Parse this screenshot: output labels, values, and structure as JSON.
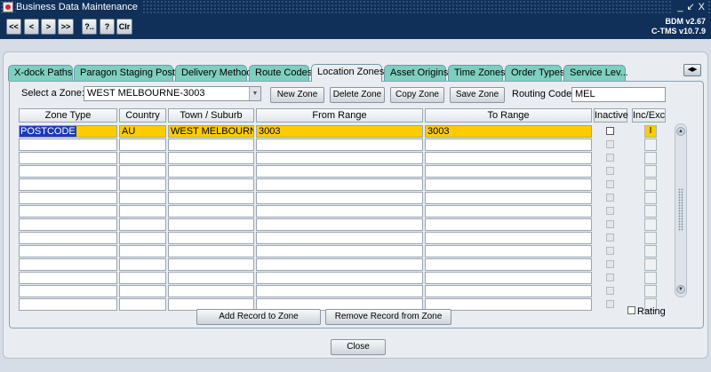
{
  "window": {
    "title": "Business Data Maintenance",
    "controls": [
      "_",
      "↙",
      "X"
    ]
  },
  "toolbar": {
    "buttons": [
      "<<",
      "<",
      ">",
      ">>",
      "?..",
      "?",
      "Clr"
    ],
    "version": "BDM v2.67",
    "version2": "C-TMS v10.7.9"
  },
  "tabs": [
    "X-dock Paths",
    "Paragon Staging Posts",
    "Delivery Method",
    "Route Codes",
    "Location Zones",
    "Asset Origins",
    "Time Zones",
    "Order Types",
    "Service Lev..."
  ],
  "active_tab": "Location Zones",
  "zone": {
    "select_label": "Select a Zone:",
    "selected": "WEST MELBOURNE-3003",
    "new_label": "New Zone",
    "delete_label": "Delete Zone",
    "copy_label": "Copy Zone",
    "save_label": "Save Zone",
    "routing_label": "Routing Code:",
    "routing_value": "MEL"
  },
  "table": {
    "headers": [
      "Zone Type",
      "Country",
      "Town / Suburb",
      "From Range",
      "To Range",
      "Inactive",
      "Inc/Exc"
    ],
    "rows": [
      {
        "zone_type": "POSTCODE",
        "country": "AU",
        "town": "WEST MELBOURNE",
        "from": "3003",
        "to": "3003",
        "inactive": false,
        "incexc": "I"
      }
    ],
    "empty_rows": 13
  },
  "actions": {
    "add_label": "Add Record to Zone",
    "remove_label": "Remove Record from Zone",
    "rating_label": "Rating",
    "close_label": "Close"
  }
}
